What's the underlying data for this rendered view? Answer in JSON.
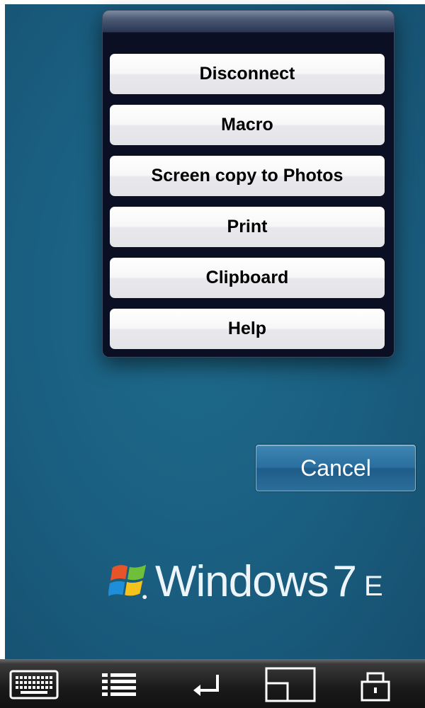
{
  "menu": {
    "items": [
      {
        "label": "Disconnect"
      },
      {
        "label": "Macro"
      },
      {
        "label": "Screen copy to Photos"
      },
      {
        "label": "Print"
      },
      {
        "label": "Clipboard"
      },
      {
        "label": "Help"
      }
    ]
  },
  "desktop": {
    "cancel_label": "Cancel",
    "branding": {
      "word": "Windows",
      "version": "7",
      "edition_fragment": "E"
    }
  },
  "toolbar": {
    "icons": [
      "keyboard-icon",
      "list-icon",
      "return-icon",
      "window-icon",
      "lock-icon"
    ]
  },
  "colors": {
    "desktop_bg": "#1a5e80",
    "popover_bg": "#0a0f24",
    "button_face": "#f2f2f4",
    "toolbar_bg": "#111111"
  }
}
